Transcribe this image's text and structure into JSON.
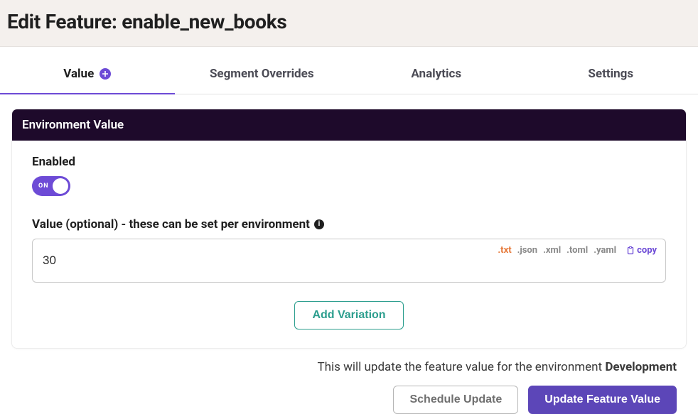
{
  "header": {
    "title": "Edit Feature: enable_new_books"
  },
  "tabs": {
    "value": "Value",
    "segment_overrides": "Segment Overrides",
    "analytics": "Analytics",
    "settings": "Settings"
  },
  "card": {
    "title": "Environment Value",
    "enabled_label": "Enabled",
    "toggle_text": "ON",
    "value_label": "Value (optional) - these can be set per environment",
    "value": "30",
    "formats": {
      "txt": ".txt",
      "json": ".json",
      "xml": ".xml",
      "toml": ".toml",
      "yaml": ".yaml"
    },
    "copy_label": "copy",
    "add_variation": "Add Variation"
  },
  "footer": {
    "text_prefix": "This will update the feature value for the environment ",
    "environment": "Development",
    "schedule_update": "Schedule Update",
    "update_feature_value": "Update Feature Value"
  }
}
